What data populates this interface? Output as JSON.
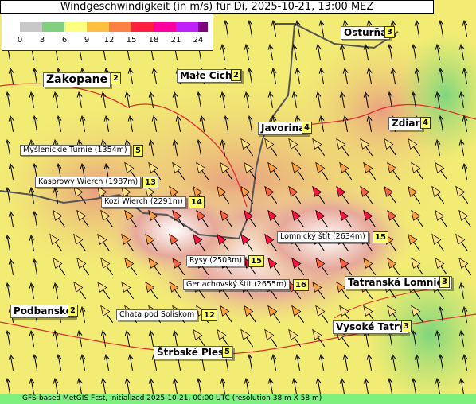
{
  "title": "Windgeschwindigkeit (in m/s) für Di, 2025-10-21, 13:00 MEZ",
  "footer": "GFS-based MetGIS Fcst, initialized 2025-10-21, 00:00 UTC  (resolution 38 m X 58 m)",
  "legend": {
    "ticks": [
      "0",
      "3",
      "6",
      "9",
      "12",
      "15",
      "18",
      "21",
      "24"
    ],
    "colors": [
      "#c8c8c8",
      "#80d080",
      "#ffff80",
      "#ffc040",
      "#ff8040",
      "#ff2040",
      "#ff00a0",
      "#c020ff",
      "#800080"
    ]
  },
  "places": [
    {
      "name": "Osturňa",
      "value": "3"
    },
    {
      "name": "Zakopane",
      "value": "2"
    },
    {
      "name": "Małe Ciche",
      "value": "2"
    },
    {
      "name": "Javorina",
      "value": "4"
    },
    {
      "name": "Ždiar",
      "value": "4"
    },
    {
      "name": "Myślenickie Turnie (1354m)",
      "value": "5"
    },
    {
      "name": "Kasprowy Wierch (1987m)",
      "value": "13"
    },
    {
      "name": "Kozi Wierch (2291m)",
      "value": "14"
    },
    {
      "name": "Lomnický štít (2634m)",
      "value": "15"
    },
    {
      "name": "Rysy (2503m)",
      "value": "15"
    },
    {
      "name": "Gerlachovský štít (2655m)",
      "value": "16"
    },
    {
      "name": "Tatranská Lomnica",
      "value": "3"
    },
    {
      "name": "Podbanské",
      "value": "2"
    },
    {
      "name": "Chata pod Soliskom",
      "value": "12"
    },
    {
      "name": "Vysoké Tatry",
      "value": "3"
    },
    {
      "name": "Štrbské Pleso",
      "value": "5"
    }
  ]
}
